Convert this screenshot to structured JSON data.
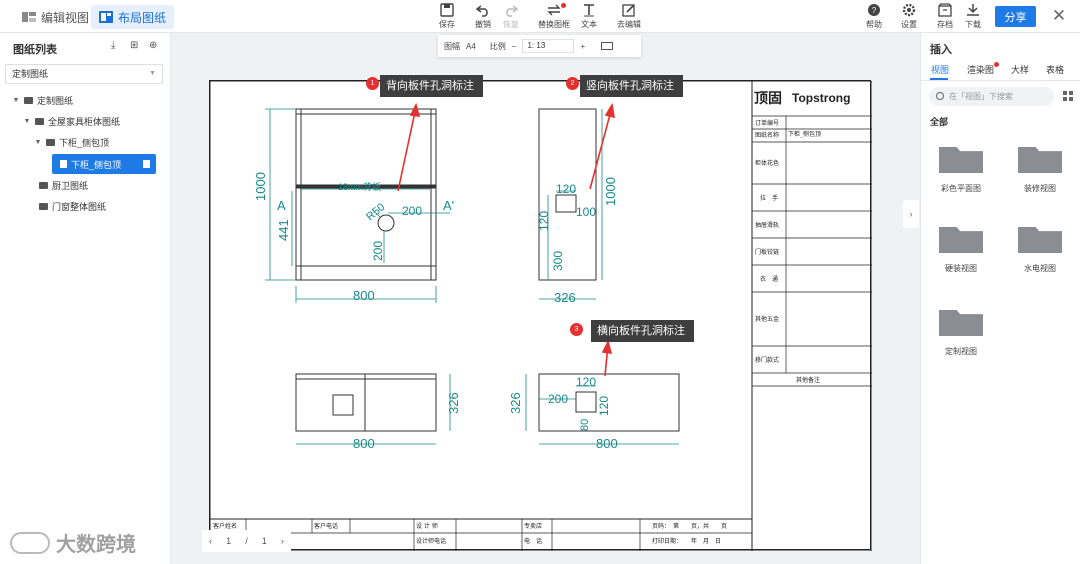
{
  "topbar": {
    "mode_tabs": [
      {
        "label": "编辑视图",
        "active": false
      },
      {
        "label": "布局图纸",
        "active": true
      }
    ],
    "tools": [
      {
        "label": "保存",
        "icon": "save-icon"
      },
      {
        "label": "撤销",
        "icon": "undo-icon"
      },
      {
        "label": "恢复",
        "icon": "redo-icon",
        "disabled": true
      },
      {
        "label": "替换图框",
        "icon": "swap-icon",
        "dot": true
      },
      {
        "label": "文本",
        "icon": "text-icon"
      },
      {
        "label": "去编辑",
        "icon": "edit-icon"
      }
    ],
    "right_tools": [
      {
        "label": "帮助",
        "icon": "help-icon"
      },
      {
        "label": "设置",
        "icon": "gear-icon"
      },
      {
        "label": "存档",
        "icon": "archive-icon"
      },
      {
        "label": "下载",
        "icon": "download-icon"
      }
    ],
    "share_label": "分享",
    "close_icon": "close-icon"
  },
  "zoombar": {
    "paper_label": "图幅",
    "paper_value": "A4",
    "scale_label": "比例",
    "minus": "−",
    "scale_value": "1: 13",
    "plus": "+"
  },
  "left_panel": {
    "title": "图纸列表",
    "select_value": "定制图纸",
    "tree": [
      {
        "label": "定制图纸",
        "level": 0,
        "expanded": true
      },
      {
        "label": "全屋家具柜体图纸",
        "level": 1,
        "expanded": true
      },
      {
        "label": "下柜_侧包顶",
        "level": 2,
        "expanded": true
      },
      {
        "label": "下柜_侧包顶",
        "level": 3,
        "selected": true
      },
      {
        "label": "厨卫图纸",
        "level": 1
      },
      {
        "label": "门窗整体图纸",
        "level": 1
      }
    ]
  },
  "pager": {
    "prev": "‹",
    "current": "1",
    "sep": "/",
    "total": "1",
    "next": "›"
  },
  "watermark": {
    "text": "大数跨境"
  },
  "annotations": [
    {
      "num": "1",
      "text": "背向板件孔洞标注"
    },
    {
      "num": "2",
      "text": "竖向板件孔洞标注"
    },
    {
      "num": "3",
      "text": "横向板件孔洞标注"
    }
  ],
  "drawing": {
    "front": {
      "w": "800",
      "h": "1000",
      "h2": "441",
      "label_back": "18mm背板",
      "r": "R50",
      "dx": "200",
      "dy": "200",
      "a": "A",
      "a2": "A'"
    },
    "side": {
      "w": "326",
      "h": "1000",
      "t1": "120",
      "t2": "100",
      "t3": "120",
      "t4": "300"
    },
    "top": {
      "w": "800",
      "d": "326"
    },
    "bottom": {
      "w": "800",
      "d": "326",
      "t1": "120",
      "t2": "200",
      "t3": "120",
      "t4": "80"
    }
  },
  "title_block": {
    "logo_cn": "顶固",
    "logo_en": "Topstrong",
    "rows": [
      "订单编号",
      "图纸名称",
      "柜体花色",
      "拉　手",
      "抽屉滑轨",
      "门板铰链",
      "衣　通",
      "其他五金",
      "移门款式"
    ],
    "drawing_name": "下柜_侧包顶",
    "remarks": "其他备注",
    "bottom_labels": [
      "客户姓名",
      "客户电话",
      "设 计 师",
      "专卖店",
      "设计师电话",
      "电　话",
      "页码：　第　　页，共　　页",
      "打印日期：　　年　月　日"
    ]
  },
  "right_panel": {
    "title": "插入",
    "tabs": [
      {
        "label": "视图",
        "active": true
      },
      {
        "label": "渲染图",
        "dot": true
      },
      {
        "label": "大样"
      },
      {
        "label": "表格"
      }
    ],
    "search_placeholder": "在「视图」下搜索",
    "section": "全部",
    "items": [
      "彩色平面图",
      "装修视图",
      "硬装视图",
      "水电视图",
      "定制视图"
    ]
  }
}
